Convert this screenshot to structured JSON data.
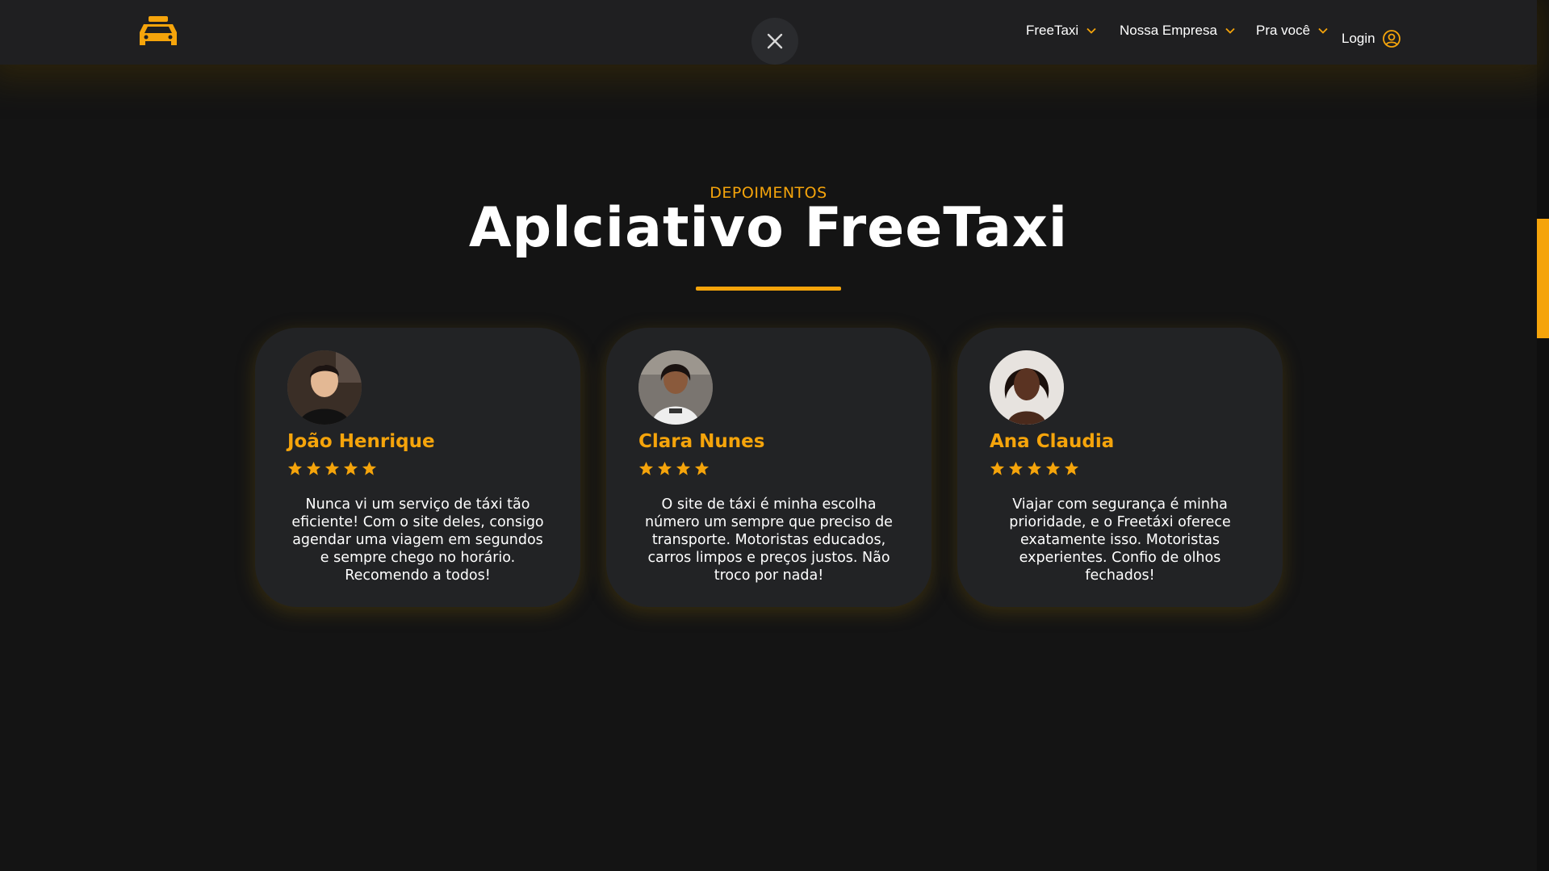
{
  "header": {
    "logo_icon": "taxi-icon",
    "close_icon": "close-icon",
    "nav": [
      {
        "label": "FreeTaxi"
      },
      {
        "label": "Nossa Empresa"
      },
      {
        "label": "Pra você"
      }
    ],
    "login_label": "Login",
    "login_icon": "user-circle-icon"
  },
  "section": {
    "eyebrow": "DEPOIMENTOS",
    "title": "Aplciativo FreeTaxi"
  },
  "testimonials": [
    {
      "name": "João Henrique",
      "rating": 5,
      "text": "Nunca vi um serviço de táxi tão eficiente! Com o site deles, consigo agendar uma viagem em segundos e sempre chego no horário. Recomendo a todos!"
    },
    {
      "name": "Clara Nunes",
      "rating": 4,
      "text": "O site de táxi é minha escolha número um sempre que preciso de transporte. Motoristas educados, carros limpos e preços justos. Não troco por nada!"
    },
    {
      "name": "Ana Claudia",
      "rating": 5,
      "text": "Viajar com segurança é minha prioridade, e o Freetáxi oferece exatamente isso. Motoristas experientes. Confio de olhos fechados!"
    }
  ],
  "colors": {
    "accent": "#f5a40b",
    "background": "#141414",
    "card": "#222325",
    "header": "#1f1f21"
  }
}
